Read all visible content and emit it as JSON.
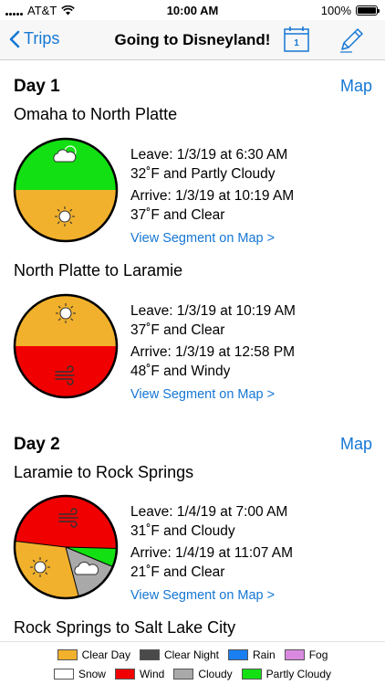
{
  "status": {
    "carrier": "AT&T",
    "time": "10:00 AM",
    "battery": "100%"
  },
  "nav": {
    "back_label": "Trips",
    "title": "Going to Disneyland!",
    "calendar_day": "1"
  },
  "days": [
    {
      "label": "Day 1",
      "map_label": "Map"
    },
    {
      "label": "Day 2",
      "map_label": "Map"
    }
  ],
  "segments": [
    {
      "title": "Omaha to North Platte",
      "leave": "Leave: 1/3/19 at 6:30 AM",
      "leave_weather": "32˚F and Partly Cloudy",
      "arrive": "Arrive: 1/3/19 at 10:19 AM",
      "arrive_weather": "37˚F and Clear",
      "link": "View Segment on Map >"
    },
    {
      "title": "North Platte to Laramie",
      "leave": "Leave: 1/3/19 at 10:19 AM",
      "leave_weather": "37˚F and Clear",
      "arrive": "Arrive: 1/3/19 at 12:58 PM",
      "arrive_weather": "48˚F and Windy",
      "link": "View Segment on Map >"
    },
    {
      "title": "Laramie to Rock Springs",
      "leave": "Leave: 1/4/19 at 7:00 AM",
      "leave_weather": "31˚F and Cloudy",
      "arrive": "Arrive: 1/4/19 at 11:07 AM",
      "arrive_weather": "21˚F and Clear",
      "link": "View Segment on Map >"
    },
    {
      "title": "Rock Springs to Salt Lake City"
    }
  ],
  "legend": {
    "row1": [
      {
        "label": "Clear Day",
        "color": "#f2b12c"
      },
      {
        "label": "Clear Night",
        "color": "#4a4a4a"
      },
      {
        "label": "Rain",
        "color": "#1a7ff0"
      },
      {
        "label": "Fog",
        "color": "#d98ae0"
      }
    ],
    "row2": [
      {
        "label": "Snow",
        "color": "#ffffff"
      },
      {
        "label": "Wind",
        "color": "#f00000"
      },
      {
        "label": "Cloudy",
        "color": "#a9a9a9"
      },
      {
        "label": "Partly Cloudy",
        "color": "#12e012"
      }
    ]
  },
  "colors": {
    "accent": "#1577d4",
    "clear_day": "#f2b12c",
    "wind": "#f00000",
    "partly_cloudy": "#12e012",
    "cloudy": "#a9a9a9"
  }
}
